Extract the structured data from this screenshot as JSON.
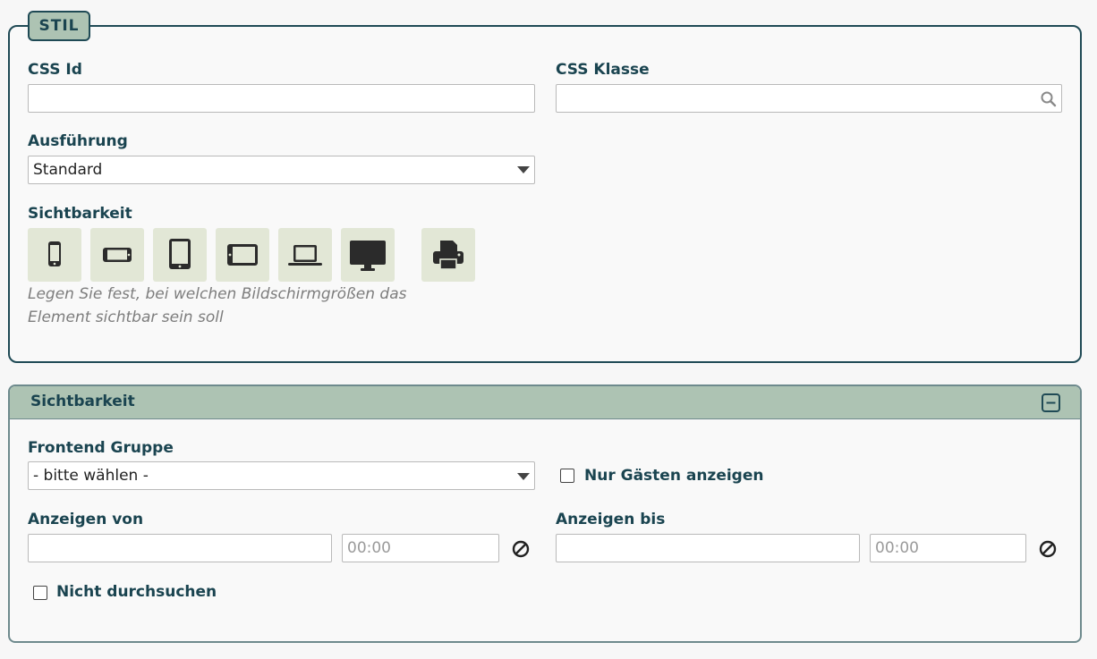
{
  "stil": {
    "legend": "STIL",
    "css_id": {
      "label": "CSS Id",
      "value": ""
    },
    "css_klasse": {
      "label": "CSS Klasse",
      "value": "",
      "icon": "search-icon"
    },
    "ausfuehrung": {
      "label": "Ausführung",
      "value": "Standard"
    },
    "sichtbarkeit": {
      "label": "Sichtbarkeit",
      "devices": [
        {
          "name": "phone-portrait-icon"
        },
        {
          "name": "phone-landscape-icon"
        },
        {
          "name": "tablet-portrait-icon"
        },
        {
          "name": "tablet-landscape-icon"
        },
        {
          "name": "laptop-icon"
        },
        {
          "name": "desktop-icon"
        },
        {
          "name": "printer-icon"
        }
      ],
      "hint": "Legen Sie fest, bei welchen Bildschirmgrößen das Element sichtbar sein soll"
    }
  },
  "panel": {
    "title": "Sichtbarkeit",
    "collapse_icon": "minus-square-icon",
    "frontend_gruppe": {
      "label": "Frontend Gruppe",
      "value": "- bitte wählen -"
    },
    "nur_gaesten": {
      "label": "Nur Gästen anzeigen",
      "checked": false
    },
    "anzeigen_von": {
      "label": "Anzeigen von",
      "date": "",
      "time_placeholder": "00:00"
    },
    "anzeigen_bis": {
      "label": "Anzeigen bis",
      "date": "",
      "time_placeholder": "00:00"
    },
    "nicht_durchsuchen": {
      "label": "Nicht durchsuchen",
      "checked": false
    }
  },
  "colors": {
    "accent": "#adc3b3",
    "border": "#1f4a55",
    "text": "#1a4450",
    "device_bg": "#e2e7d6"
  }
}
